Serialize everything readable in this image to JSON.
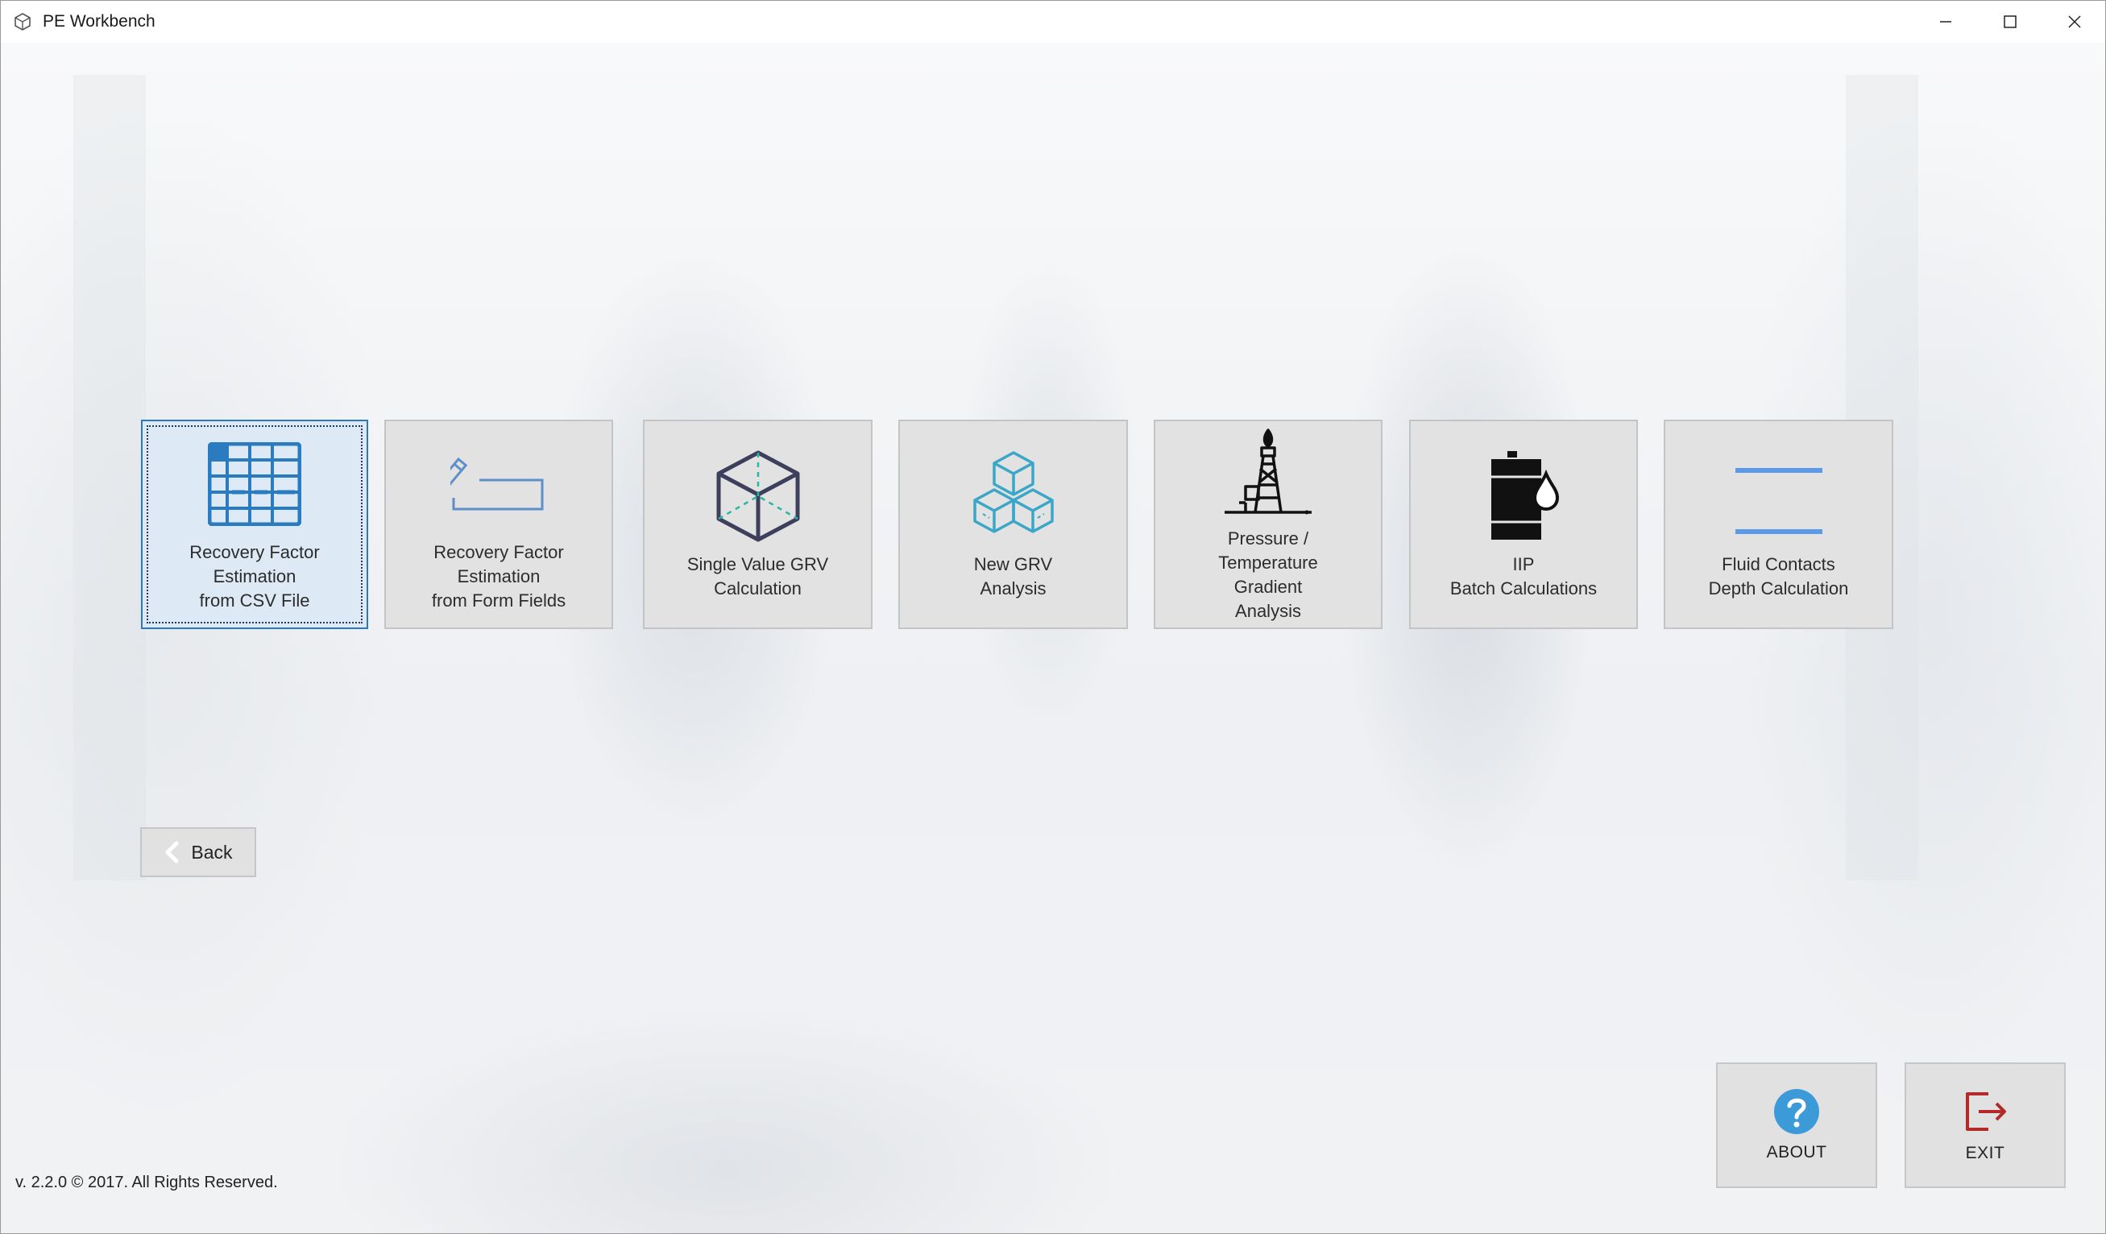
{
  "window": {
    "title": "PE Workbench",
    "controls": [
      "minimize",
      "maximize",
      "close"
    ]
  },
  "tiles": [
    {
      "id": "rf-csv",
      "label": "Recovery Factor\nEstimation\nfrom CSV File",
      "icon": "table-icon",
      "selected": true
    },
    {
      "id": "rf-form",
      "label": "Recovery Factor\nEstimation\nfrom Form Fields",
      "icon": "form-edit-icon",
      "selected": false
    },
    {
      "id": "grv-single",
      "label": "Single Value GRV\nCalculation",
      "icon": "cube-icon",
      "selected": false
    },
    {
      "id": "grv-new",
      "label": "New GRV\nAnalysis",
      "icon": "stacked-cubes-icon",
      "selected": false
    },
    {
      "id": "pt-gradient",
      "label": "Pressure /\nTemperature\nGradient\nAnalysis",
      "icon": "drilling-rig-icon",
      "selected": false
    },
    {
      "id": "iip-batch",
      "label": "IIP\nBatch Calculations",
      "icon": "oil-barrel-icon",
      "selected": false
    },
    {
      "id": "fluid-contacts",
      "label": "Fluid Contacts\nDepth Calculation",
      "icon": "contact-lines-icon",
      "selected": false
    }
  ],
  "back": {
    "label": "Back"
  },
  "about": {
    "label": "ABOUT"
  },
  "exit": {
    "label": "EXIT"
  },
  "footer": {
    "text": "v. 2.2.0 © 2017. All Rights Reserved."
  },
  "colors": {
    "accent_blue": "#2b7bc0",
    "cube_dark": "#3d3f5c",
    "cube_teal": "#3aa6c8",
    "exit_red": "#b22a2a",
    "about_blue": "#3c9ad9"
  }
}
